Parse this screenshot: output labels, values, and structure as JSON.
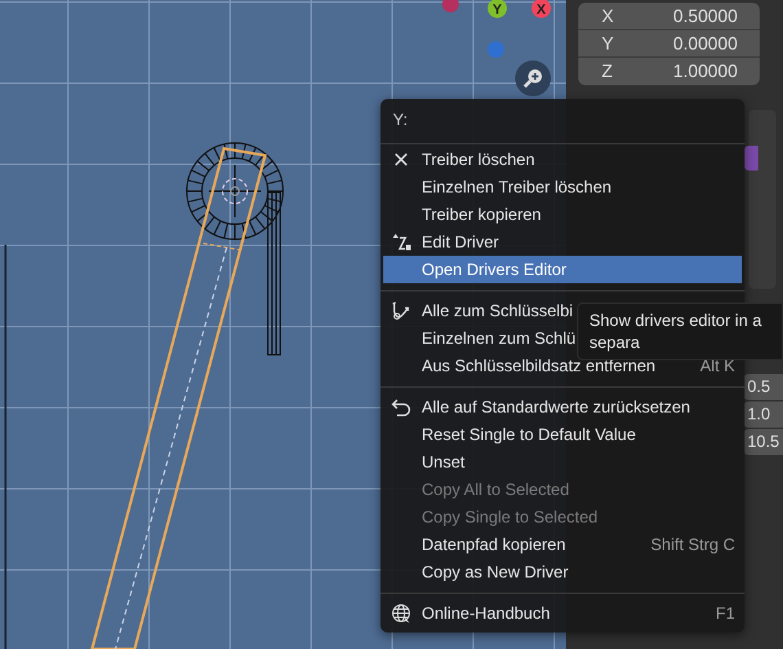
{
  "viewport": {
    "gizmo": [
      {
        "color": "#b5305e"
      },
      {
        "label": "Y",
        "color": "#7fbf2a"
      },
      {
        "label": "X",
        "color": "#f2445a"
      },
      {
        "color": "#2f6fd0"
      }
    ]
  },
  "properties": {
    "location": [
      {
        "axis": "X",
        "value": "0.50000"
      },
      {
        "axis": "Y",
        "value": "0.00000"
      },
      {
        "axis": "Z",
        "value": "1.00000"
      }
    ],
    "column_3": [
      "0.5",
      "1.0",
      "10.5"
    ]
  },
  "context_menu": {
    "title": "Y:",
    "items": [
      {
        "kind": "separator"
      },
      {
        "kind": "item",
        "label": "Treiber löschen",
        "selected": false,
        "disabled": false
      },
      {
        "kind": "item",
        "label": "Einzelnen Treiber löschen",
        "selected": false,
        "disabled": false
      },
      {
        "kind": "item",
        "label": "Treiber kopieren",
        "selected": false,
        "disabled": false
      },
      {
        "kind": "item",
        "label": "Edit Driver",
        "selected": false,
        "disabled": false
      },
      {
        "kind": "item",
        "label": "Open Drivers Editor",
        "selected": true,
        "disabled": false
      },
      {
        "kind": "separator"
      },
      {
        "kind": "item",
        "label": "Alle zum Schlüsselbi",
        "selected": false,
        "disabled": false
      },
      {
        "kind": "item",
        "label": "Einzelnen zum Schlü",
        "selected": false,
        "disabled": false
      },
      {
        "kind": "item",
        "label": "Aus Schlüsselbildsatz entfernen",
        "shortcut": "Alt K",
        "selected": false,
        "disabled": false
      },
      {
        "kind": "separator"
      },
      {
        "kind": "item",
        "label": "Alle auf Standardwerte zurücksetzen",
        "selected": false,
        "disabled": false
      },
      {
        "kind": "item",
        "label": "Reset Single to Default Value",
        "selected": false,
        "disabled": false
      },
      {
        "kind": "item",
        "label": "Unset",
        "selected": false,
        "disabled": false
      },
      {
        "kind": "item",
        "label": "Copy All to Selected",
        "selected": false,
        "disabled": true
      },
      {
        "kind": "item",
        "label": "Copy Single to Selected",
        "selected": false,
        "disabled": true
      },
      {
        "kind": "item",
        "label": "Datenpfad kopieren",
        "shortcut": "Shift Strg C",
        "selected": false,
        "disabled": false
      },
      {
        "kind": "item",
        "label": "Copy as New Driver",
        "selected": false,
        "disabled": false
      },
      {
        "kind": "separator"
      },
      {
        "kind": "item",
        "label": "Online-Handbuch",
        "shortcut": "F1",
        "selected": false,
        "disabled": false
      }
    ]
  },
  "tooltip": {
    "text": "Show drivers editor in a separa"
  }
}
